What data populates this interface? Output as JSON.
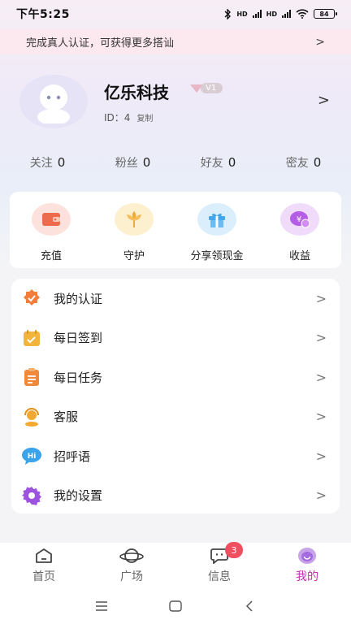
{
  "status_bar": {
    "time": "下午5:25",
    "network_1": "HD",
    "network_2": "HD",
    "battery": "84"
  },
  "notice": {
    "text": "完成真人认证，可获得更多搭讪",
    "arrow": ">"
  },
  "profile": {
    "nickname": "亿乐科技",
    "level": "V1",
    "id_label": "ID：4",
    "copy_label": "复制",
    "arrow": ">"
  },
  "stats": [
    {
      "label": "关注",
      "value": "0"
    },
    {
      "label": "粉丝",
      "value": "0"
    },
    {
      "label": "好友",
      "value": "0"
    },
    {
      "label": "密友",
      "value": "0"
    }
  ],
  "quick_actions": [
    {
      "label": "充值",
      "icon": "wallet-icon",
      "bg": "#fde1dc",
      "fg": "#ee6a4c"
    },
    {
      "label": "守护",
      "icon": "flower-icon",
      "bg": "#fdf0cf",
      "fg": "#f2a93b"
    },
    {
      "label": "分享领现金",
      "icon": "gift-icon",
      "bg": "#dbeefc",
      "fg": "#45a6ea"
    },
    {
      "label": "收益",
      "icon": "coins-icon",
      "bg": "#f0dbfb",
      "fg": "#b35ce6"
    }
  ],
  "menu": [
    {
      "label": "我的认证",
      "icon": "certification-badge-icon",
      "color": "#f47d3a"
    },
    {
      "label": "每日签到",
      "icon": "calendar-check-icon",
      "color": "#f2b53c"
    },
    {
      "label": "每日任务",
      "icon": "clipboard-task-icon",
      "color": "#f08a3a"
    },
    {
      "label": "客服",
      "icon": "customer-service-icon",
      "color": "#f3a92f"
    },
    {
      "label": "招呼语",
      "icon": "greeting-bubble-icon",
      "color": "#3aa3ea"
    },
    {
      "label": "我的设置",
      "icon": "gear-icon",
      "color": "#9b53e0"
    }
  ],
  "menu_arrow": ">",
  "tabs": [
    {
      "label": "首页",
      "icon": "home-icon"
    },
    {
      "label": "广场",
      "icon": "planet-icon"
    },
    {
      "label": "信息",
      "icon": "message-icon",
      "badge": "3"
    },
    {
      "label": "我的",
      "icon": "profile-face-icon",
      "active": true
    }
  ],
  "colors": {
    "accent": "#c42fb0",
    "badge": "#ef4f5e",
    "notice_bg": "#fbe9ef"
  }
}
